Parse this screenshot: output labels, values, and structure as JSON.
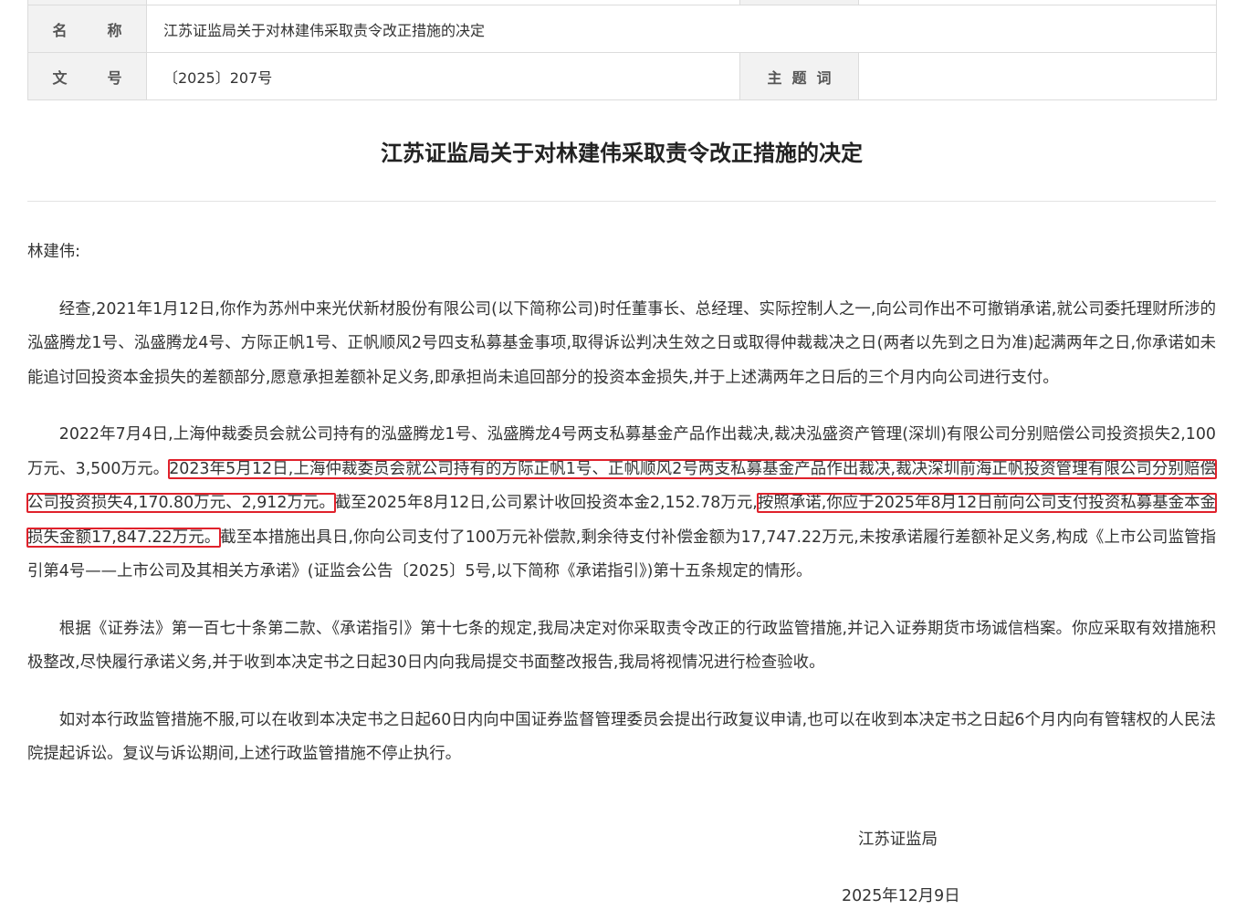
{
  "meta": {
    "name_label": "名　称",
    "name_value": "江苏证监局关于对林建伟采取责令改正措施的决定",
    "docno_label": "文　号",
    "docno_value": "〔2025〕207号",
    "subject_label": "主 题 词",
    "subject_value": ""
  },
  "doc": {
    "title": "江苏证监局关于对林建伟采取责令改正措施的决定",
    "salutation": "林建伟:",
    "p1": "经查,2021年1月12日,你作为苏州中来光伏新材股份有限公司(以下简称公司)时任董事长、总经理、实际控制人之一,向公司作出不可撤销承诺,就公司委托理财所涉的泓盛腾龙1号、泓盛腾龙4号、方际正帆1号、正帆顺风2号四支私募基金事项,取得诉讼判决生效之日或取得仲裁裁决之日(两者以先到之日为准)起满两年之日,你承诺如未能追讨回投资本金损失的差额部分,愿意承担差额补足义务,即承担尚未追回部分的投资本金损失,并于上述满两年之日后的三个月内向公司进行支付。",
    "p2_a": "2022年7月4日,上海仲裁委员会就公司持有的泓盛腾龙1号、泓盛腾龙4号两支私募基金产品作出裁决,裁决泓盛资产管理(深圳)有限公司分别赔偿公司投资损失2,100万元、3,500万元。",
    "p2_b": "2023年5月12日,上海仲裁委员会就公司持有的方际正帆1号、正帆顺风2号两支私募基金产品作出裁决,裁决深圳前海正帆投资管理有限公司分别赔偿公司投资损失4,170.80万元、2,912万元。",
    "p2_c": "截至2025年8月12日,公司累计收回投资本金2,152.78万元,",
    "p2_d": "按照承诺,你应于2025年8月12日前向公司支付投资私募基金本金损失金额17,847.22万元。",
    "p2_e": "截至本措施出具日,你向公司支付了100万元补偿款,剩余待支付补偿金额为17,747.22万元,未按承诺履行差额补足义务,构成《上市公司监管指引第4号——上市公司及其相关方承诺》(证监会公告〔2025〕5号,以下简称《承诺指引》)第十五条规定的情形。",
    "p3": "根据《证券法》第一百七十条第二款、《承诺指引》第十七条的规定,我局决定对你采取责令改正的行政监管措施,并记入证券期货市场诚信档案。你应采取有效措施积极整改,尽快履行承诺义务,并于收到本决定书之日起30日内向我局提交书面整改报告,我局将视情况进行检查验收。",
    "p4": "如对本行政监管措施不服,可以在收到本决定书之日起60日内向中国证券监督管理委员会提出行政复议申请,也可以在收到本决定书之日起6个月内向有管辖权的人民法院提起诉讼。复议与诉讼期间,上述行政监管措施不停止执行。",
    "signature": "江苏证监局",
    "date": "2025年12月9日"
  },
  "colors": {
    "highlight_border": "#e0212b",
    "label_bg": "#f2f2f2"
  }
}
